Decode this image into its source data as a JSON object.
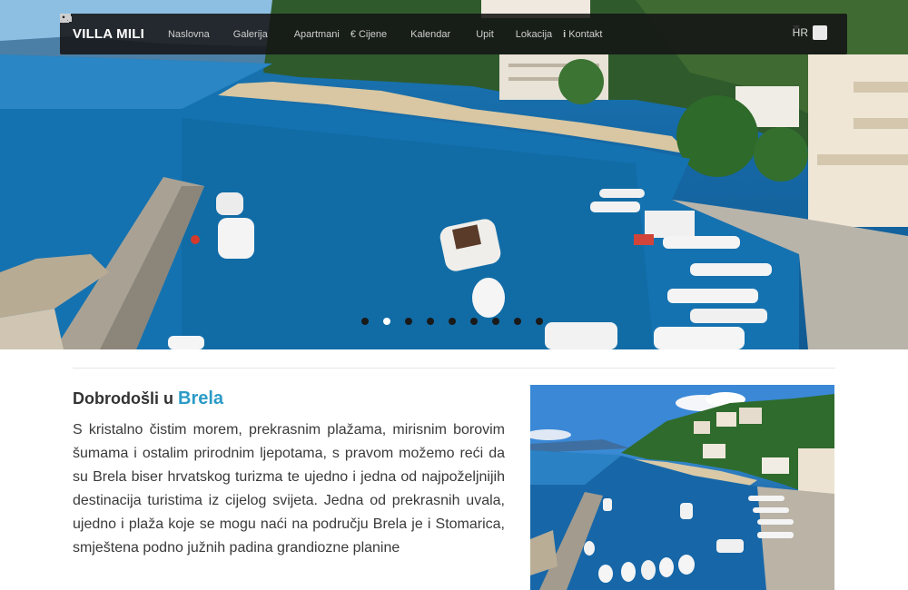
{
  "navbar": {
    "brand": "VILLA MILI",
    "items": [
      {
        "label": "Naslovna",
        "icon": "home-icon"
      },
      {
        "label": "Galerija",
        "icon": "picture-icon"
      },
      {
        "label": "Apartmani",
        "icon": "bed-icon"
      },
      {
        "label": "Cijene",
        "icon": "euro-icon"
      },
      {
        "label": "Kalendar",
        "icon": "calendar-icon"
      },
      {
        "label": "Upit",
        "icon": "envelope-icon"
      },
      {
        "label": "Lokacija",
        "icon": "map-marker-icon"
      },
      {
        "label": "Kontakt",
        "icon": "info-icon"
      }
    ],
    "language": "HR"
  },
  "slider": {
    "dot_count": 9,
    "active_index": 1
  },
  "content": {
    "welcome_prefix": "Dobrodošli u",
    "welcome_place": "Brela",
    "intro": "S kristalno čistim morem, prekrasnim plažama, mirisnim borovim šumama i ostalim prirodnim ljepotama, s pravom možemo reći da su Brela biser hrvatskog turizma te ujedno i jedna od najpoželjnijih destinacija turistima iz cijelog svijeta. Jedna od prekrasnih uvala, ujedno i plaža koje se mogu naći na području Brela je i Stomarica, smještena podno južnih padina grandiozne planine"
  },
  "colors": {
    "accent": "#2b9bc6",
    "navbar_bg": "#141414",
    "text": "#3a3a3a"
  }
}
